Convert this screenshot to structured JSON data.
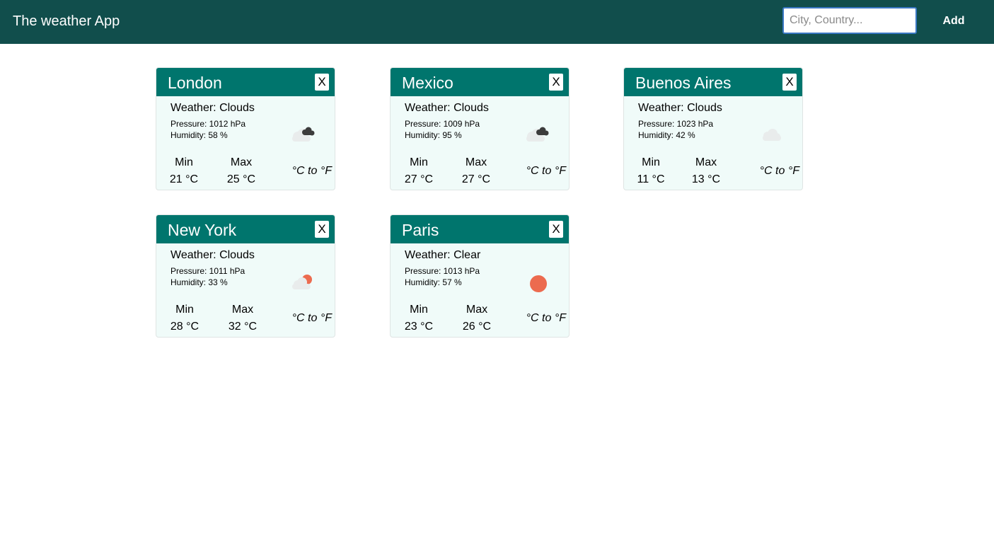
{
  "app": {
    "title": "The weather App"
  },
  "search": {
    "placeholder": "City, Country...",
    "value": ""
  },
  "toolbar": {
    "add_label": "Add"
  },
  "labels": {
    "close": "X",
    "min": "Min",
    "max": "Max",
    "convert": "°C to °F"
  },
  "cards": [
    {
      "city": "London",
      "weather": "Weather: Clouds",
      "pressure": "Pressure: 1012 hPa",
      "humidity": "Humidity: 58 %",
      "min": "21 °C",
      "max": "25 °C",
      "icon": "broken-clouds-icon"
    },
    {
      "city": "Mexico",
      "weather": "Weather: Clouds",
      "pressure": "Pressure: 1009 hPa",
      "humidity": "Humidity: 95 %",
      "min": "27 °C",
      "max": "27 °C",
      "icon": "broken-clouds-icon"
    },
    {
      "city": "Buenos Aires",
      "weather": "Weather: Clouds",
      "pressure": "Pressure: 1023 hPa",
      "humidity": "Humidity: 42 %",
      "min": "11 °C",
      "max": "13 °C",
      "icon": "scattered-clouds-icon"
    },
    {
      "city": "New York",
      "weather": "Weather: Clouds",
      "pressure": "Pressure: 1011 hPa",
      "humidity": "Humidity: 33 %",
      "min": "28 °C",
      "max": "32 °C",
      "icon": "few-clouds-icon"
    },
    {
      "city": "Paris",
      "weather": "Weather: Clear",
      "pressure": "Pressure: 1013 hPa",
      "humidity": "Humidity: 57 %",
      "min": "23 °C",
      "max": "26 °C",
      "icon": "clear-sky-icon"
    }
  ],
  "colors": {
    "navbar": "#114e4c",
    "card_header": "#00756d",
    "card_body": "#f0fbf9",
    "sun": "#ec6b4f",
    "dark_cloud": "#3c3c3c",
    "light_cloud": "#e9ecec"
  }
}
